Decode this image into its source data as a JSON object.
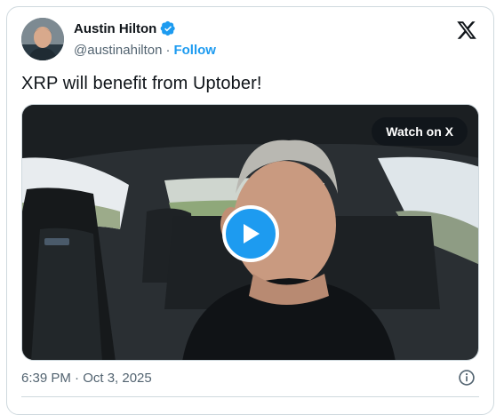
{
  "author": {
    "name": "Austin Hilton",
    "handle": "@austinahilton",
    "separator": "·",
    "follow_label": "Follow",
    "verified_icon": "verified-badge-icon"
  },
  "tweet": {
    "text": "XRP will benefit from Uptober!"
  },
  "media": {
    "watch_label": "Watch on X",
    "play_icon": "play-icon"
  },
  "footer": {
    "timestamp": "6:39 PM · Oct 3, 2025",
    "info_icon": "info-icon"
  },
  "colors": {
    "accent": "#1d9bf0",
    "text": "#0f1419",
    "muted": "#536471",
    "border": "#cfd9de"
  }
}
